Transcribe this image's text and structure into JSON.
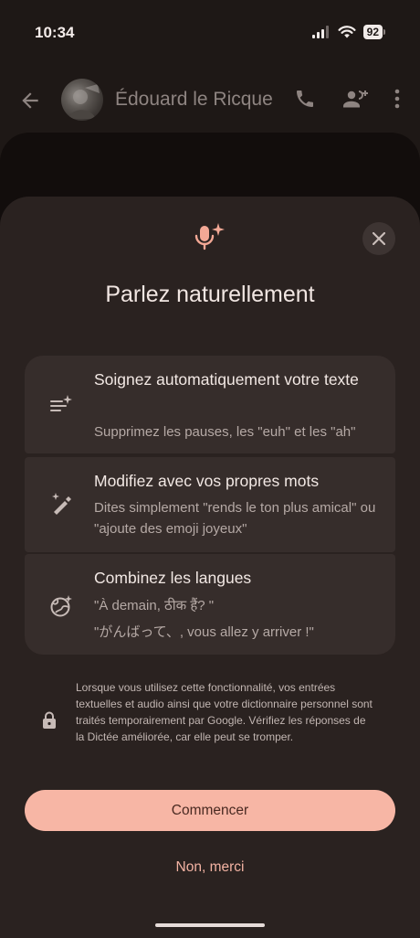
{
  "status_bar": {
    "time": "10:34",
    "battery": "92",
    "icons": [
      "cellular-signal-icon",
      "wifi-icon",
      "battery-icon"
    ]
  },
  "app_bar": {
    "contact_name": "Édouard le Ricque",
    "icons": [
      "back-arrow-icon",
      "phone-icon",
      "add-person-icon",
      "more-vert-icon"
    ]
  },
  "sheet": {
    "title": "Parlez naturellement",
    "header_icon": "sparkle-mic-icon",
    "close_icon": "close-icon",
    "features": [
      {
        "icon": "auto-clean-text-icon",
        "title": "Soignez automatiquement votre texte",
        "desc": "Supprimez les pauses, les \"euh\" et les \"ah\""
      },
      {
        "icon": "magic-pen-icon",
        "title": "Modifiez avec vos propres mots",
        "desc": "Dites simplement \"rends le ton plus amical\" ou \"ajoute des emoji joyeux\""
      },
      {
        "icon": "globe-sparkle-icon",
        "title": "Combinez les langues",
        "desc_line1": "\"À demain, ठीक हैं?  \"",
        "desc_line2": "\"がんばって、, vous allez y arriver !\""
      }
    ],
    "privacy_text": "Lorsque vous utilisez cette fonctionnalité, vos entrées textuelles et audio ainsi que votre dictionnaire personnel sont traités temporairement par Google. Vérifiez les réponses de la Dictée améliorée, car elle peut se tromper.",
    "start_label": "Commencer",
    "decline_label": "Non, merci"
  },
  "colors": {
    "accent": "#f7b6a5",
    "sheet_bg": "#2a2220",
    "card_bg": "#362d2b"
  }
}
